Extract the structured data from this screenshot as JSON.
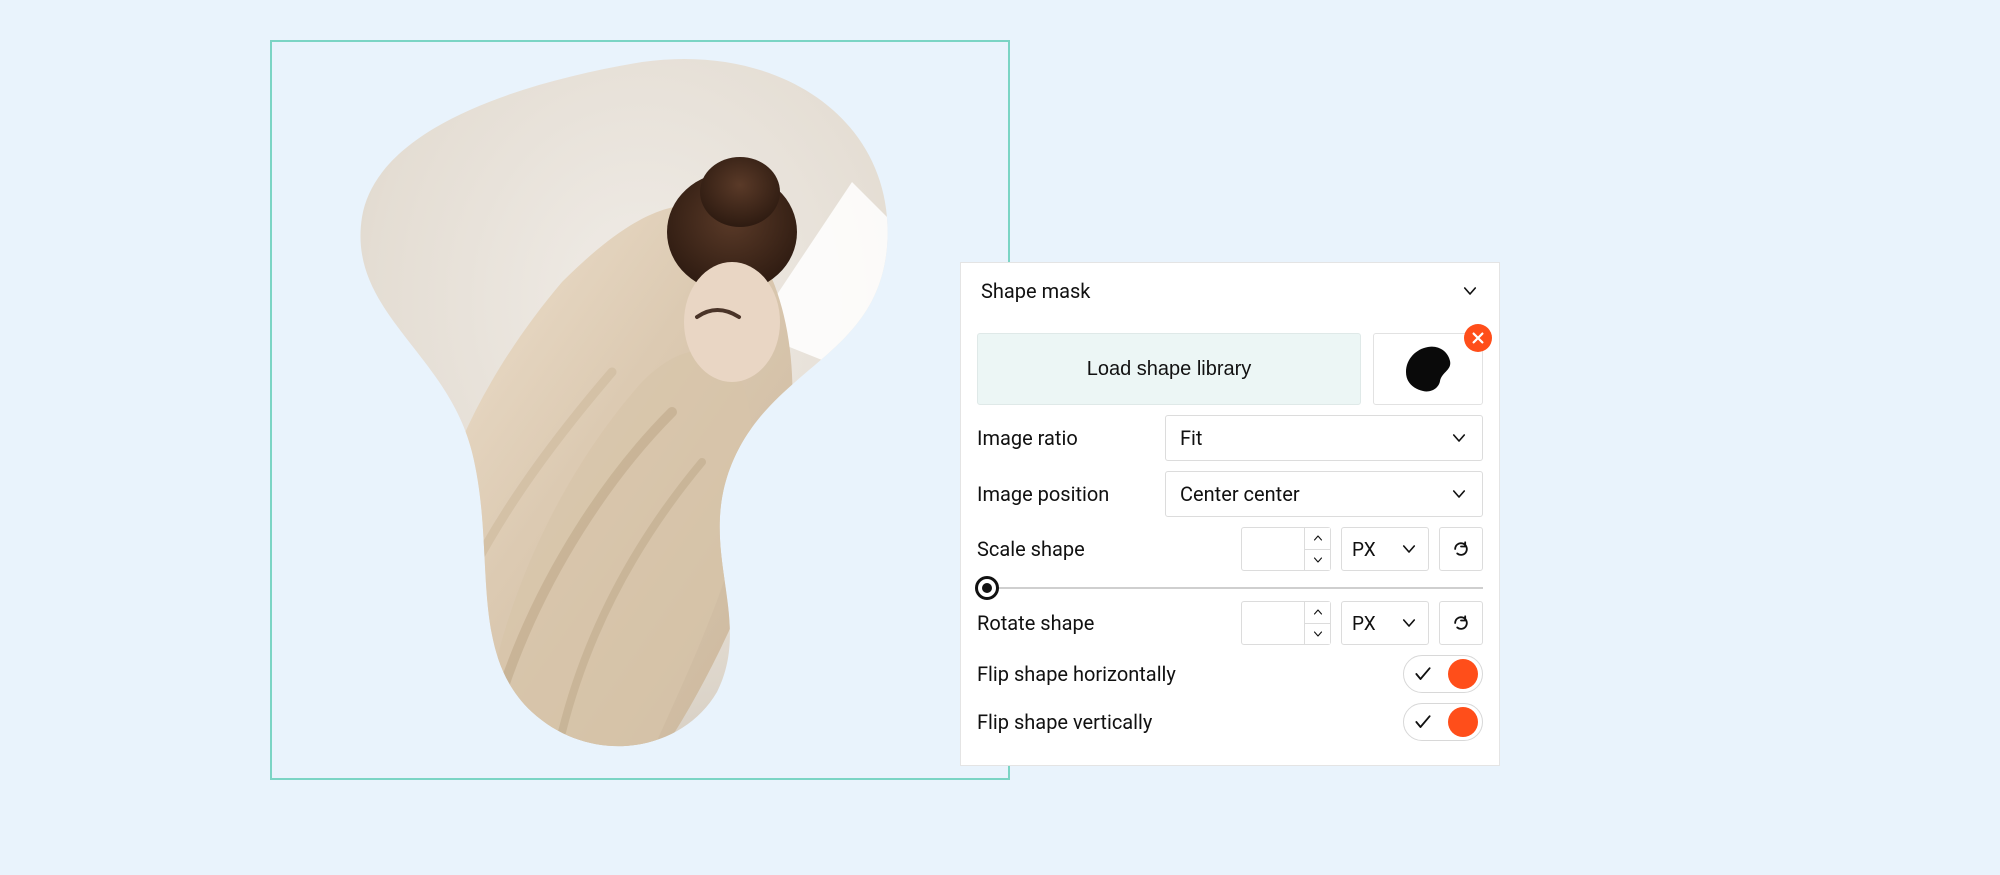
{
  "panel": {
    "title": "Shape mask",
    "load_button": "Load shape library",
    "image_ratio": {
      "label": "Image ratio",
      "value": "Fit"
    },
    "image_position": {
      "label": "Image position",
      "value": "Center center"
    },
    "scale": {
      "label": "Scale shape",
      "value": "",
      "unit": "PX"
    },
    "rotate": {
      "label": "Rotate shape",
      "value": "",
      "unit": "PX"
    },
    "flip_h": {
      "label": "Flip shape horizontally",
      "on": true
    },
    "flip_v": {
      "label": "Flip shape vertically",
      "on": true
    }
  }
}
